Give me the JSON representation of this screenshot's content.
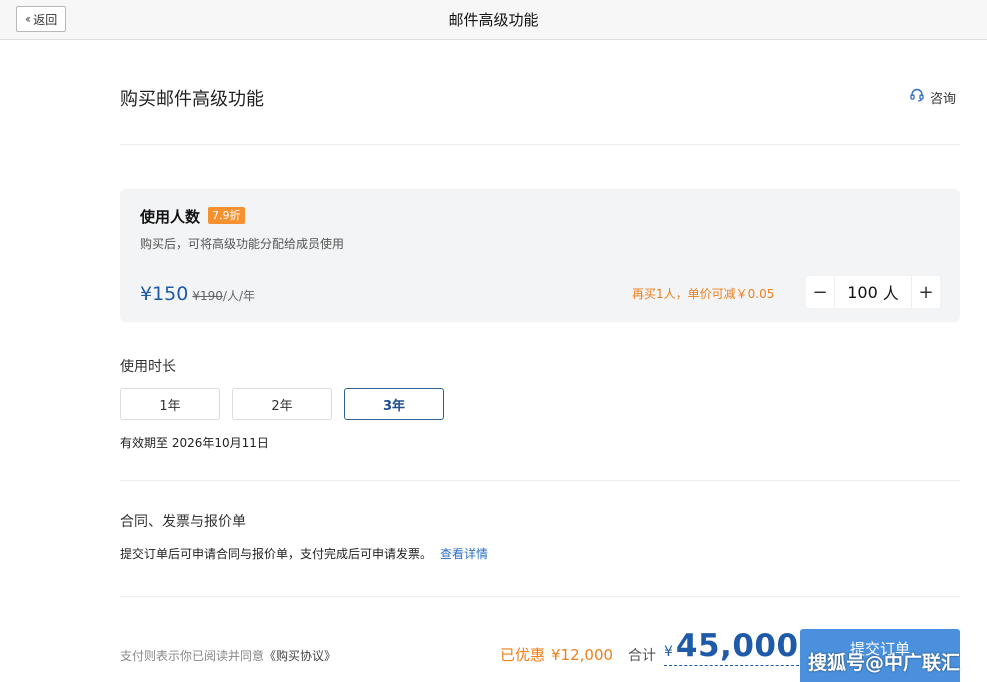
{
  "topbar": {
    "back_label": "返回",
    "back_icon": "double-chevron-left-icon",
    "title": "邮件高级功能"
  },
  "header": {
    "title": "购买邮件高级功能",
    "consult_label": "咨询",
    "consult_icon": "headset-icon"
  },
  "users": {
    "title": "使用人数",
    "discount": "7.9折",
    "description": "购买后，可将高级功能分配给成员使用",
    "price_now": "¥150",
    "price_old": "¥190",
    "price_unit": "/人/年",
    "promo": "再买1人，单价可减￥0.05",
    "quantity": "100",
    "quantity_unit": "人",
    "minus_symbol": "−",
    "plus_symbol": "+"
  },
  "duration": {
    "label": "使用时长",
    "options": [
      "1年",
      "2年",
      "3年"
    ],
    "selected": "3年",
    "valid_until": "有效期至 2026年10月11日"
  },
  "contract": {
    "title": "合同、发票与报价单",
    "text": "提交订单后可申请合同与报价单，支付完成后可申请发票。",
    "link": "查看详情"
  },
  "footer": {
    "agree_text": "支付则表示你已阅读并同意",
    "agree_link": "《购买协议》",
    "saved_label": "已优惠",
    "saved_amount": "¥12,000",
    "total_label": "合计",
    "total_currency": "¥",
    "total_value": "45,000",
    "submit_label": "提交订单",
    "watermark": "搜狐号@中广联汇"
  },
  "colors": {
    "accent_blue": "#1f5aa8",
    "accent_orange": "#ef7f1a",
    "badge_orange": "#f5912f",
    "submit_blue": "#4a90dc",
    "link_blue": "#2c6fc1"
  }
}
